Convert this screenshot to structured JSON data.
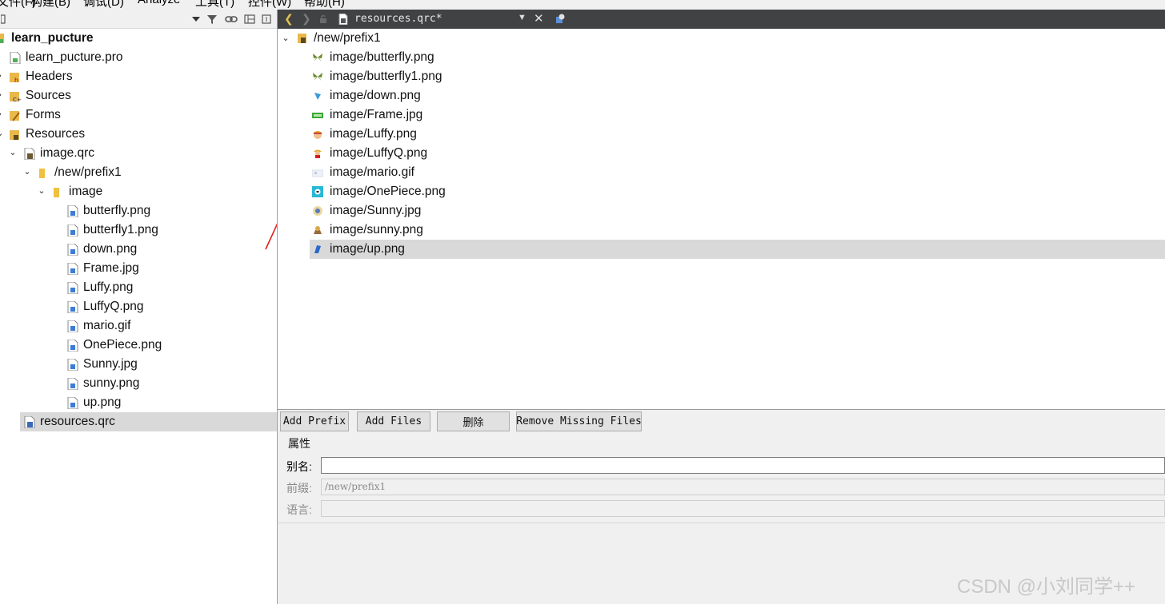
{
  "menubar": {
    "items": [
      "文件(F)",
      "构建(B)",
      "调试(D)",
      "Analyze",
      "工具(T)",
      "控件(W)",
      "帮助(H)"
    ]
  },
  "left_toolbar": {
    "filter_icon": "filter-icon",
    "link_icon": "link-icon",
    "split_icon": "split-icon",
    "close_icon": "close-pane-icon"
  },
  "project_tree": [
    {
      "label": "learn_pucture",
      "icon": "qt-project-icon",
      "bold": true
    },
    {
      "label": "learn_pucture.pro",
      "icon": "pro-file-icon"
    },
    {
      "label": "Headers",
      "icon": "headers-folder-icon"
    },
    {
      "label": "Sources",
      "icon": "sources-folder-icon"
    },
    {
      "label": "Forms",
      "icon": "forms-folder-icon"
    },
    {
      "label": "Resources",
      "icon": "resources-folder-icon"
    },
    {
      "label": "image.qrc",
      "icon": "qrc-file-icon"
    },
    {
      "label": "/new/prefix1",
      "icon": "prefix-folder-icon"
    },
    {
      "label": "image",
      "icon": "folder-icon"
    },
    {
      "label": "butterfly.png",
      "icon": "image-file-icon"
    },
    {
      "label": "butterfly1.png",
      "icon": "image-file-icon"
    },
    {
      "label": "down.png",
      "icon": "image-file-icon"
    },
    {
      "label": "Frame.jpg",
      "icon": "image-file-icon"
    },
    {
      "label": "Luffy.png",
      "icon": "image-file-icon"
    },
    {
      "label": "LuffyQ.png",
      "icon": "image-file-icon"
    },
    {
      "label": "mario.gif",
      "icon": "image-file-icon"
    },
    {
      "label": "OnePiece.png",
      "icon": "image-file-icon"
    },
    {
      "label": "Sunny.jpg",
      "icon": "image-file-icon"
    },
    {
      "label": "sunny.png",
      "icon": "image-file-icon"
    },
    {
      "label": "up.png",
      "icon": "image-file-icon"
    },
    {
      "label": "resources.qrc",
      "icon": "qrc-file-icon",
      "selected": true
    }
  ],
  "editor_toolbar": {
    "back_icon": "back-arrow-icon",
    "forward_icon": "forward-arrow-icon",
    "lock_icon": "lock-icon",
    "file_icon": "qrc-file-icon",
    "file_name": "resources.qrc*",
    "dropdown_icon": "dropdown-icon",
    "close_icon": "close-icon",
    "split_icon": "split-view-icon"
  },
  "resource_tree": {
    "prefix": "/new/prefix1",
    "items": [
      {
        "label": "image/butterfly.png",
        "icon": "butterfly-thumbnail-icon"
      },
      {
        "label": "image/butterfly1.png",
        "icon": "butterfly-thumbnail-icon"
      },
      {
        "label": "image/down.png",
        "icon": "down-thumbnail-icon"
      },
      {
        "label": "image/Frame.jpg",
        "icon": "frame-thumbnail-icon"
      },
      {
        "label": "image/Luffy.png",
        "icon": "luffy-thumbnail-icon"
      },
      {
        "label": "image/LuffyQ.png",
        "icon": "luffyq-thumbnail-icon"
      },
      {
        "label": "image/mario.gif",
        "icon": "mario-thumbnail-icon"
      },
      {
        "label": "image/OnePiece.png",
        "icon": "onepiece-thumbnail-icon"
      },
      {
        "label": "image/Sunny.jpg",
        "icon": "sunny-thumbnail-icon"
      },
      {
        "label": "image/sunny.png",
        "icon": "sunny-thumbnail-icon"
      },
      {
        "label": "image/up.png",
        "icon": "up-thumbnail-icon",
        "selected": true
      }
    ]
  },
  "bottom_panel": {
    "add_prefix": "Add Prefix",
    "add_files": "Add Files",
    "delete": "删除",
    "remove_missing": "Remove Missing Files",
    "properties_title": "属性",
    "alias_label": "别名:",
    "alias_value": "",
    "prefix_label": "前缀:",
    "prefix_value": "/new/prefix1",
    "language_label": "语言:",
    "language_value": ""
  },
  "watermark": "CSDN @小刘同学++",
  "colors": {
    "editor_toolbar_bg": "#404244",
    "selection_bg": "#d9d9d9",
    "arrow_red": "#e02020"
  }
}
